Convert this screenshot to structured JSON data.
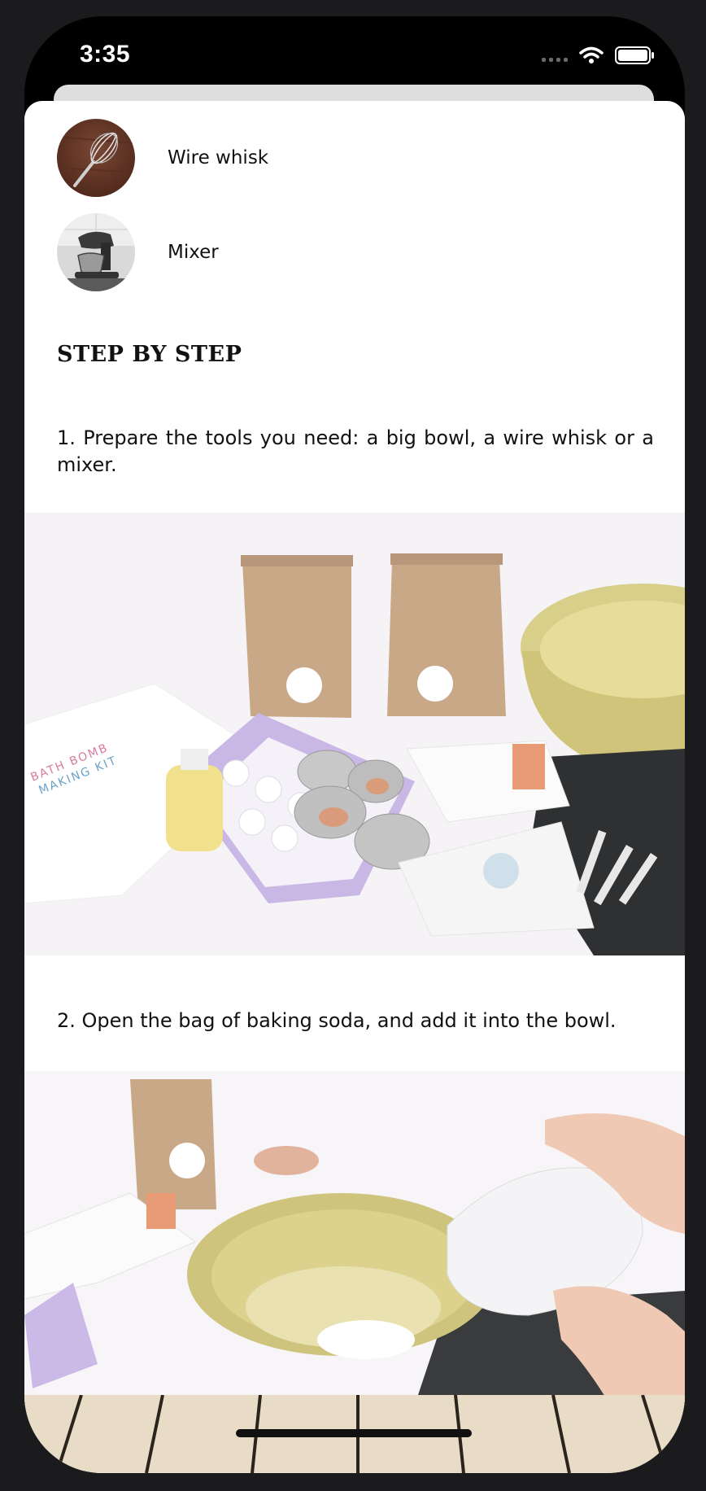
{
  "status": {
    "time": "3:35"
  },
  "tools": [
    {
      "label": "Wire whisk",
      "icon": "wire-whisk-photo"
    },
    {
      "label": "Mixer",
      "icon": "stand-mixer-photo"
    }
  ],
  "section_heading": "STEP BY STEP",
  "steps": [
    {
      "text": "1. Prepare the tools you need: a big bowl, a wire whisk or a mixer."
    },
    {
      "text": "2. Open the bag of baking soda, and add it into the bowl."
    }
  ],
  "photo1": {
    "kit_title_line1": "BATH BOMB",
    "kit_title_line2": "MAKING KIT",
    "colors": {
      "bowl": "#d8d08a",
      "paper_bag": "#c9a888",
      "lilac": "#c9b8e6",
      "slate": "#2f3032"
    }
  }
}
